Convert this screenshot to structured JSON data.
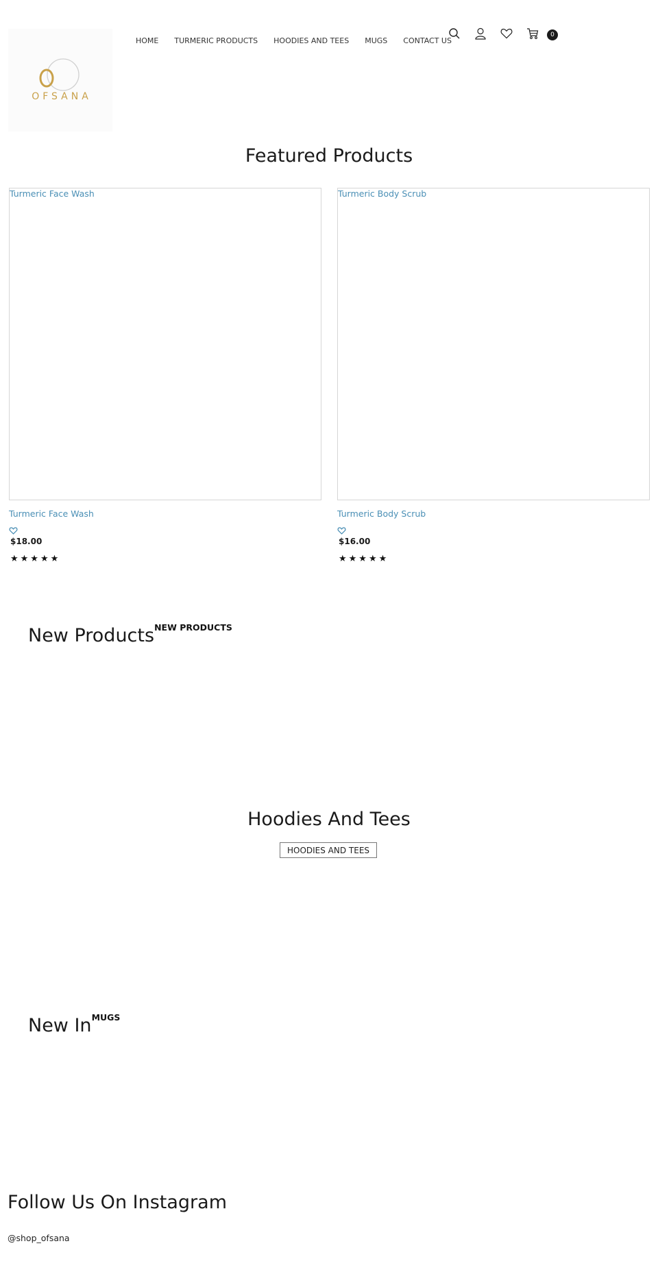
{
  "brand": {
    "name": "OFSANA",
    "monogram": "O",
    "gold": "#c9a14a",
    "ring": "#d0d0d0"
  },
  "nav": {
    "items": [
      {
        "label": "HOME"
      },
      {
        "label": "TURMERIC PRODUCTS"
      },
      {
        "label": "HOODIES AND TEES"
      },
      {
        "label": "MUGS"
      },
      {
        "label": "CONTACT US"
      }
    ]
  },
  "header_icons": {
    "search": "search-icon",
    "account": "user-icon",
    "wishlist": "heart-icon",
    "cart": "cart-icon",
    "cart_count": "0"
  },
  "featured": {
    "title": "Featured Products",
    "products": [
      {
        "image_alt": "Turmeric Face Wash",
        "name": "Turmeric Face Wash",
        "price": "$18.00",
        "rating": 5,
        "stars": "★★★★★"
      },
      {
        "image_alt": "Turmeric Body Scrub",
        "name": "Turmeric Body Scrub",
        "price": "$16.00",
        "rating": 5,
        "stars": "★★★★★"
      }
    ]
  },
  "new_products": {
    "title": "New Products",
    "link": "NEW PRODUCTS"
  },
  "hoodies": {
    "title": "Hoodies And Tees",
    "button": "HOODIES AND TEES"
  },
  "new_in": {
    "title": "New In",
    "link": "MUGS"
  },
  "instagram": {
    "title": "Follow Us On Instagram",
    "handle": "@shop_ofsana"
  },
  "colors": {
    "link": "#4a8fb5",
    "text": "#1a1a1a",
    "border": "#d6d6d6"
  }
}
